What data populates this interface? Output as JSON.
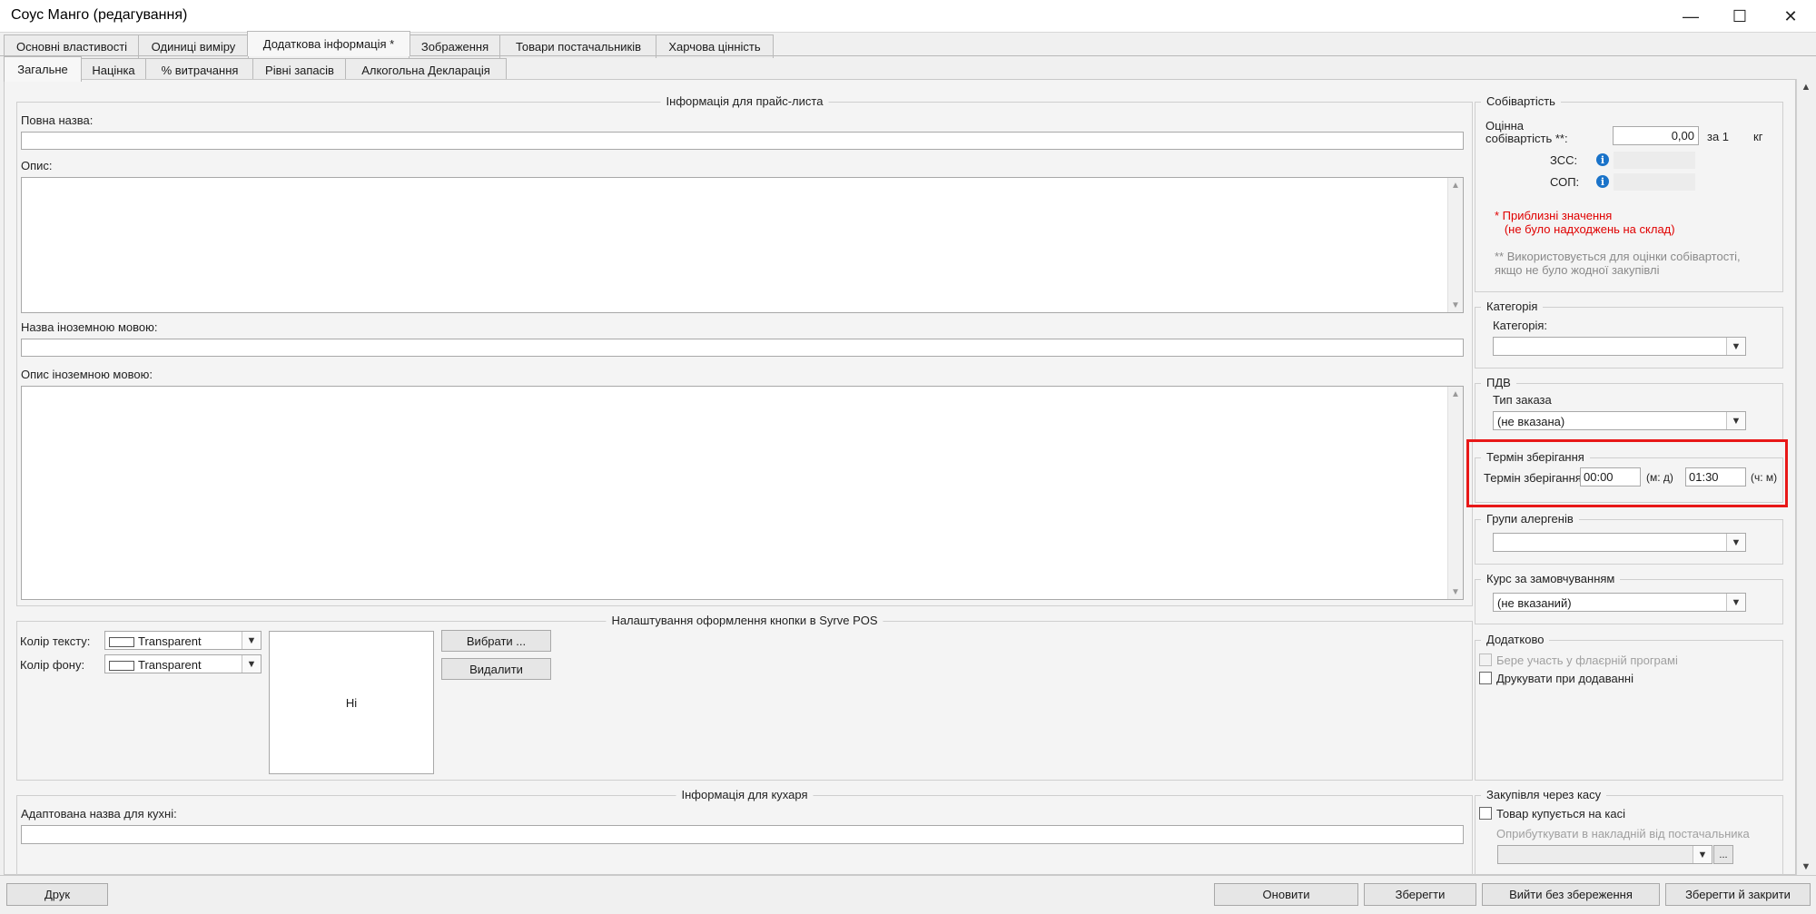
{
  "window": {
    "title": "Соус Манго (редагування)",
    "minimize_glyph": "—",
    "maximize_glyph": "☐",
    "close_glyph": "✕"
  },
  "tabs_top": [
    {
      "label": "Основні властивості"
    },
    {
      "label": "Одиниці виміру"
    },
    {
      "label": "Додаткова інформація *",
      "active": true
    },
    {
      "label": "Зображення"
    },
    {
      "label": "Товари постачальників"
    },
    {
      "label": "Харчова цінність"
    }
  ],
  "tabs_sub": [
    {
      "label": "Загальне",
      "active": true
    },
    {
      "label": "Націнка"
    },
    {
      "label": "% витрачання"
    },
    {
      "label": "Рівні запасів"
    },
    {
      "label": "Алкогольна Декларація"
    }
  ],
  "price_list": {
    "title": "Інформація для прайс-листа",
    "full_name_label": "Повна назва:",
    "full_name_value": "",
    "description_label": "Опис:",
    "description_value": "",
    "foreign_name_label": "Назва іноземною мовою:",
    "foreign_name_value": "",
    "foreign_desc_label": "Опис іноземною мовою:",
    "foreign_desc_value": ""
  },
  "button_style": {
    "title": "Налаштування оформлення кнопки в Syrve POS",
    "text_color_label": "Колір тексту:",
    "text_color_value": "Transparent",
    "bg_color_label": "Колір фону:",
    "bg_color_value": "Transparent",
    "preview_text": "Ні",
    "choose_button": "Вибрати ...",
    "delete_button": "Видалити"
  },
  "cook_info": {
    "title": "Інформація для кухаря",
    "kitchen_name_label": "Адаптована назва для кухні:",
    "kitchen_name_value": ""
  },
  "cost": {
    "title": "Собівартість",
    "estimated_label_line1": "Оцінна",
    "estimated_label_line2": "собівартість **:",
    "estimated_value": "0,00",
    "per_text": "за 1",
    "unit": "кг",
    "zss_label": "ЗСС:",
    "sop_label": "СОП:",
    "note_red": "* Приблизні значення\n   (не було надходжень на склад)",
    "note_gray": "** Використовується для оцінки собівартості,\nякщо не було жодної закупівлі"
  },
  "category": {
    "title": "Категорія",
    "label": "Категорія:",
    "value": ""
  },
  "vat": {
    "title": "ПДВ",
    "label": "Тип заказа",
    "value": "(не вказана)"
  },
  "storage": {
    "title": "Термін зберігання",
    "label": "Термін зберігання:",
    "value_md": "00:00",
    "unit_md": "(м: д)",
    "value_hm": "01:30",
    "unit_hm": "(ч: м)"
  },
  "allergens": {
    "title": "Групи алергенів",
    "value": ""
  },
  "default_rate": {
    "title": "Курс за замовчуванням",
    "value": "(не вказаний)"
  },
  "additional": {
    "title": "Додатково",
    "flyer_label": "Бере участь у флаєрній програмі",
    "flyer_checked": false,
    "print_label": "Друкувати при додаванні",
    "print_checked": false
  },
  "cash_purchase": {
    "title": "Закупівля через касу",
    "bought_label": "Товар купується на касі",
    "bought_checked": false,
    "post_label": "Оприбуткувати в накладній від постачальника",
    "post_value": "",
    "ellipsis": "..."
  },
  "footer": {
    "print": "Друк",
    "refresh": "Оновити",
    "save": "Зберегти",
    "exit_no_save": "Вийти без збереження",
    "save_close": "Зберегти й закрити"
  },
  "colors": {
    "highlight": "#e81818",
    "note_red": "#e00000",
    "info_icon": "#1a73c9"
  }
}
